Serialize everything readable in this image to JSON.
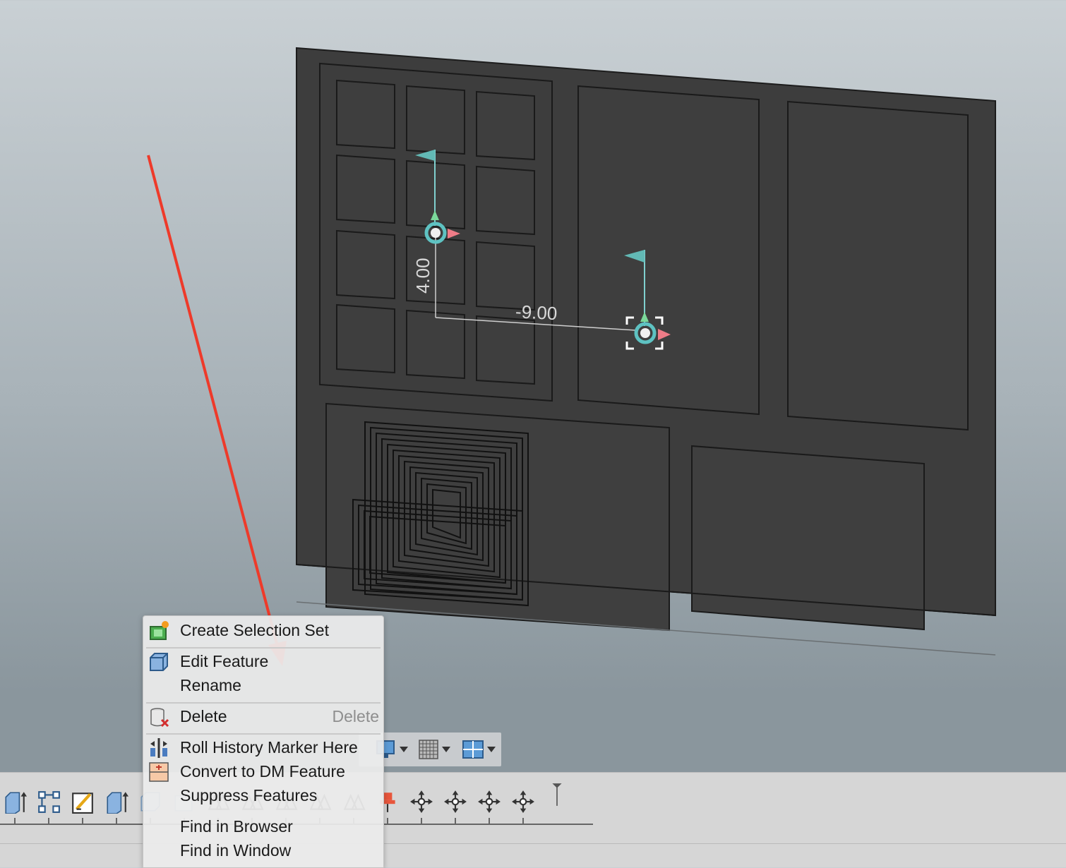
{
  "viewport": {
    "dimension_vertical": "4.00",
    "dimension_horizontal": "-9.00"
  },
  "context_menu": {
    "items": [
      {
        "label": "Create Selection Set",
        "icon": "selection-set-icon"
      },
      {
        "label": "Edit Feature",
        "icon": "edit-feature-icon"
      },
      {
        "label": "Rename",
        "icon": ""
      },
      {
        "label": "Delete",
        "icon": "delete-icon",
        "shortcut": "Delete"
      },
      {
        "label": "Roll History Marker Here",
        "icon": "roll-history-icon"
      },
      {
        "label": "Convert to DM Feature",
        "icon": "convert-dm-icon"
      },
      {
        "label": "Suppress Features",
        "icon": ""
      },
      {
        "label": "Find in Browser",
        "icon": ""
      },
      {
        "label": "Find in Window",
        "icon": ""
      }
    ]
  },
  "view_toolbar": [
    "display-mode-icon",
    "grid-icon",
    "layout-icon"
  ],
  "timeline": {
    "icons": [
      "extrude-icon",
      "pattern-icon",
      "sketch-icon",
      "extrude-icon",
      "body-icon",
      "construction-icon",
      "plane-icon",
      "plane-icon",
      "plane-icon",
      "plane-icon",
      "plane-icon",
      "pin-icon",
      "move-icon",
      "move-icon",
      "move-icon",
      "move-icon",
      "history-marker-icon"
    ]
  },
  "annotation": {
    "color": "#ee3a2a"
  }
}
